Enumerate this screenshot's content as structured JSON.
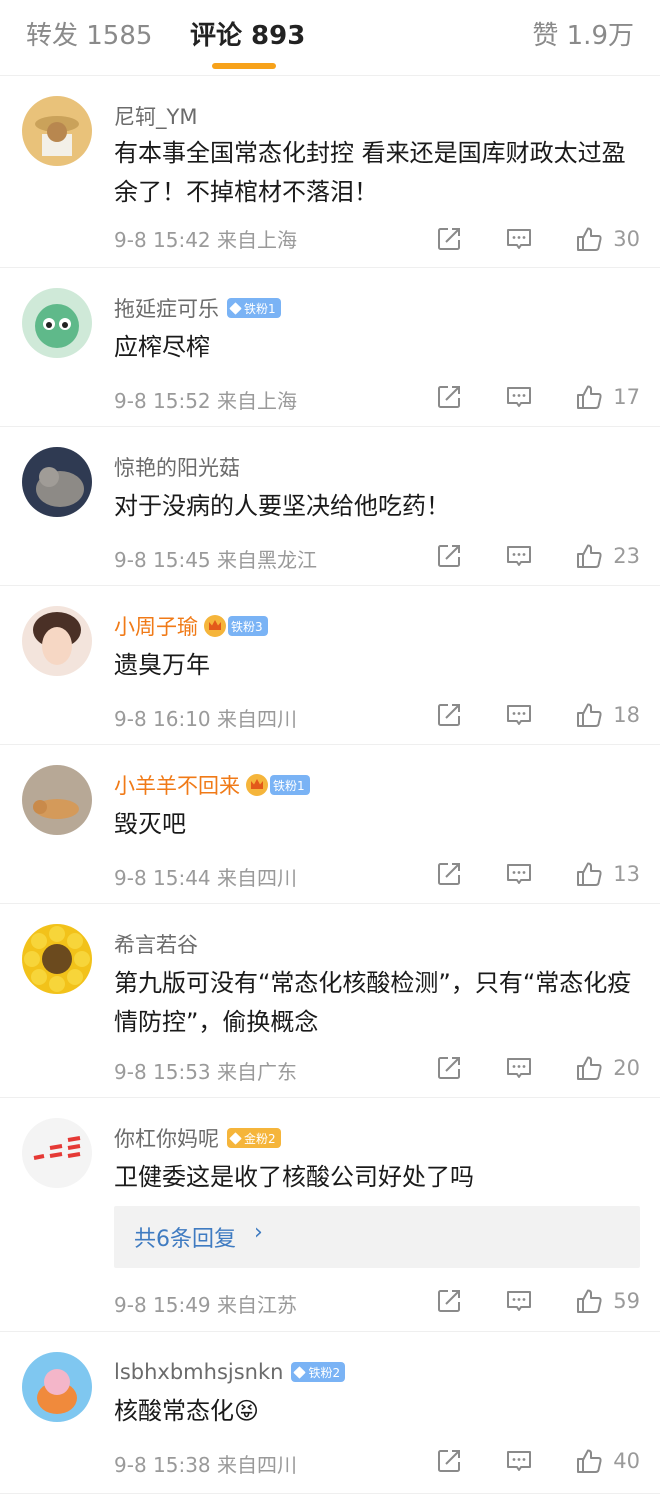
{
  "tabs": {
    "repost": "转发 1585",
    "comments": "评论 893",
    "likes": "赞 1.9万"
  },
  "comments": [
    {
      "username": "尼轲_YM",
      "text": "有本事全国常态化封控  看来还是国库财政太过盈余了！不掉棺材不落泪！",
      "time": "9-8 15:42 来自上海",
      "likes": "30"
    },
    {
      "username": "拖延症可乐",
      "badge": "铁粉1",
      "text": "应榨尽榨",
      "time": "9-8 15:52 来自上海",
      "likes": "17"
    },
    {
      "username": "惊艳的阳光菇",
      "text": "对于没病的人要坚决给他吃药！",
      "time": "9-8 15:45 来自黑龙江",
      "likes": "23"
    },
    {
      "username": "小周子瑜",
      "badge": "铁粉3",
      "text": "遗臭万年",
      "time": "9-8 16:10 来自四川",
      "likes": "18"
    },
    {
      "username": "小羊羊不回来",
      "badge": "铁粉1",
      "text": "毁灭吧",
      "time": "9-8 15:44 来自四川",
      "likes": "13"
    },
    {
      "username": "希言若谷",
      "text": "第九版可没有“常态化核酸检测”，只有“常态化疫情防控”，偷换概念",
      "time": "9-8 15:53 来自广东",
      "likes": "20"
    },
    {
      "username": "你杠你妈呢",
      "badge": "金粉2",
      "text": "卫健委这是收了核酸公司好处了吗",
      "replies": "共6条回复",
      "time": "9-8 15:49 来自江苏",
      "likes": "59"
    },
    {
      "username": "lsbhxbmhsjsnkn",
      "badge": "铁粉2",
      "text": "核酸常态化",
      "emoji": "😝",
      "time": "9-8 15:38 来自四川",
      "likes": "40"
    }
  ],
  "icons": {
    "share": "share-icon",
    "reply": "comment-icon",
    "like": "thumbs-up-icon",
    "chevron": "chevron-right-icon"
  },
  "colors": {
    "accent": "#f7a21a",
    "vip_name": "#f07a17",
    "link": "#3f7bc1",
    "iron_fan": "#7ab3f5",
    "gold_fan": "#f5b53b"
  }
}
